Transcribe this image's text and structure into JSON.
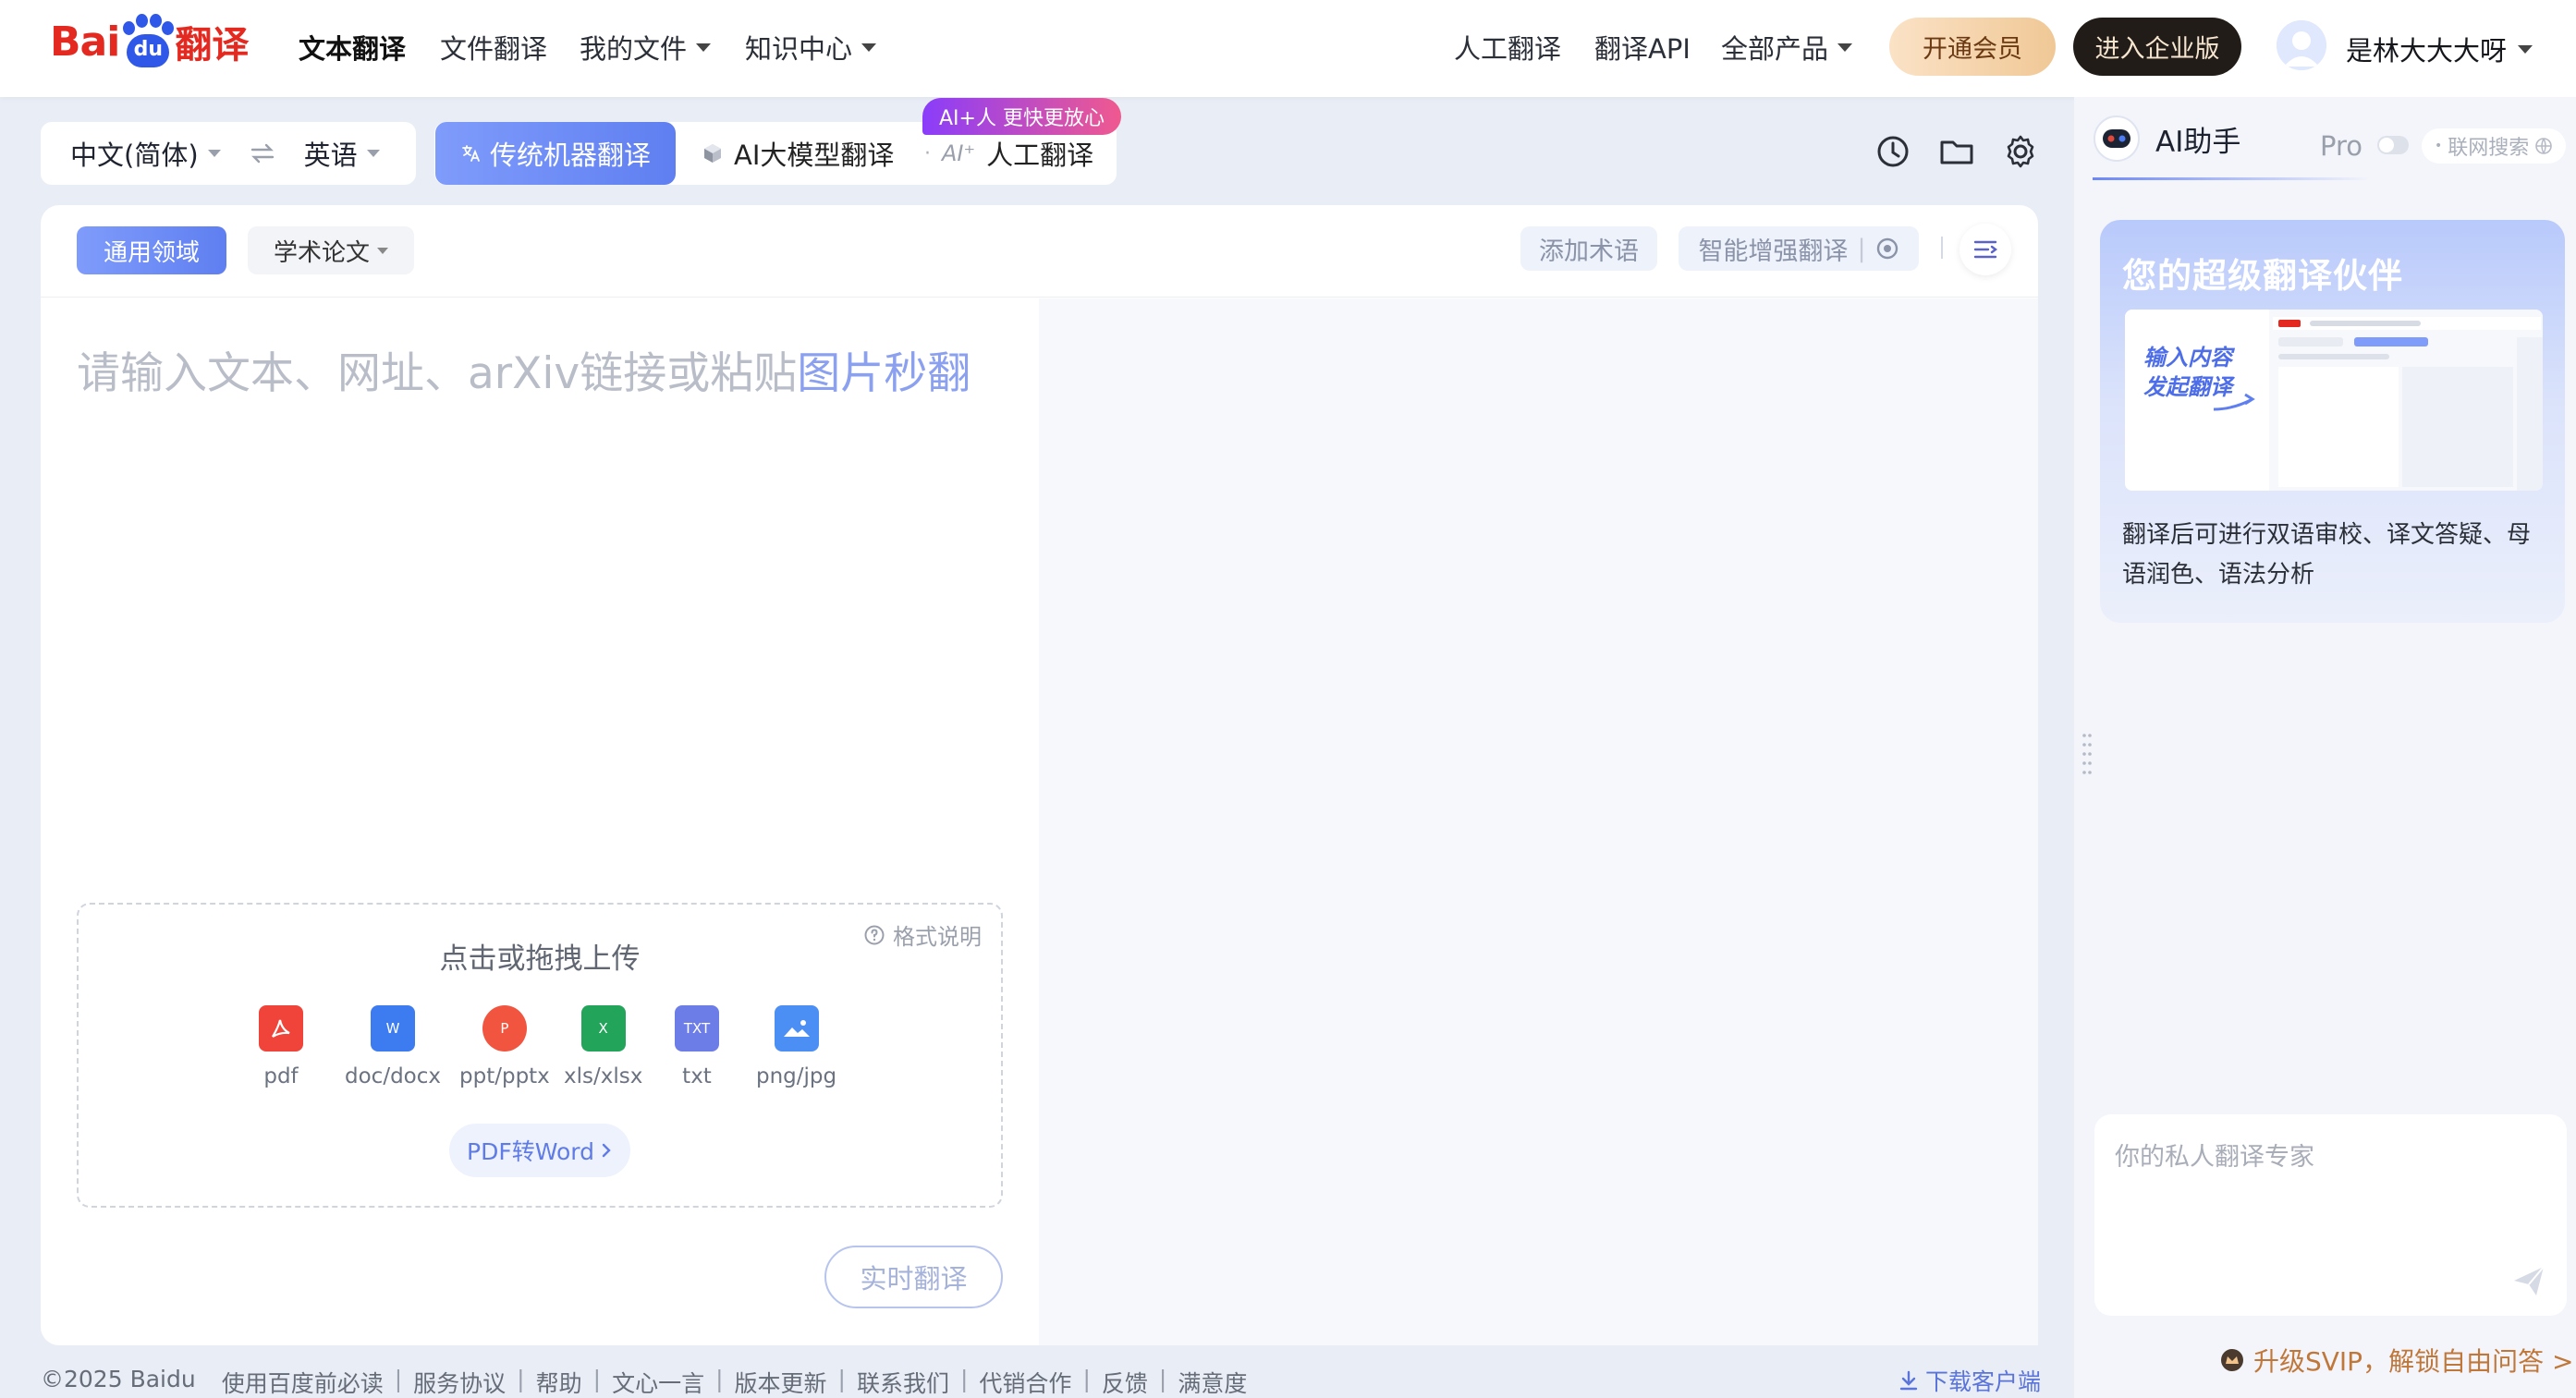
{
  "logo": {
    "bai": "Bai",
    "du": "du",
    "fanyi": "翻译"
  },
  "nav": {
    "left": [
      {
        "label": "文本翻译",
        "active": true,
        "caret": false
      },
      {
        "label": "文件翻译",
        "active": false,
        "caret": false
      },
      {
        "label": "我的文件",
        "active": false,
        "caret": true
      },
      {
        "label": "知识中心",
        "active": false,
        "caret": true
      }
    ],
    "right": [
      {
        "label": "人工翻译",
        "caret": false
      },
      {
        "label": "翻译API",
        "caret": false
      },
      {
        "label": "全部产品",
        "caret": true
      }
    ],
    "vip_button": "开通会员",
    "enterprise_button": "进入企业版",
    "username": "是林大大大呀"
  },
  "toolbar": {
    "source_lang": "中文(简体)",
    "target_lang": "英语",
    "swap_icon": "swap-arrows-icon",
    "modes": {
      "machine": "传统机器翻译",
      "llm": "AI大模型翻译",
      "human": "人工翻译",
      "human_badge": "AI+人 更快更放心"
    },
    "icons": [
      "history-icon",
      "folder-icon",
      "settings-icon"
    ]
  },
  "domain": {
    "general": "通用领域",
    "academic": "学术论文",
    "add_term": "添加术语",
    "enhance": "智能增强翻译"
  },
  "input": {
    "placeholder_main": "请输入文本、网址、arXiv链接或粘贴",
    "placeholder_link": "图片秒翻"
  },
  "upload": {
    "title": "点击或拖拽上传",
    "format_help": "格式说明",
    "types": [
      {
        "label": "pdf",
        "icon": "pdf-file-icon",
        "color": "#f0443a"
      },
      {
        "label": "doc/docx",
        "icon": "word-file-icon",
        "color": "#3d7cf0"
      },
      {
        "label": "ppt/pptx",
        "icon": "ppt-file-icon",
        "color": "#f2553f"
      },
      {
        "label": "xls/xlsx",
        "icon": "excel-file-icon",
        "color": "#22a55b"
      },
      {
        "label": "txt",
        "icon": "txt-file-icon",
        "color": "#6d7de8"
      },
      {
        "label": "png/jpg",
        "icon": "image-file-icon",
        "color": "#4b8ff5"
      }
    ],
    "pdf_to_word": "PDF转Word",
    "realtime": "实时翻译"
  },
  "footer": {
    "copyright": "©2025 Baidu",
    "links": [
      "使用百度前必读",
      "服务协议",
      "帮助",
      "文心一言",
      "版本更新",
      "联系我们",
      "代销合作",
      "反馈",
      "满意度"
    ],
    "download": "下载客户端"
  },
  "ai_panel": {
    "title": "AI助手",
    "pro": "Pro",
    "web_search": "联网搜索",
    "promo_title": "您的超级翻译伙伴",
    "promo_shot_text": "输入内容\n发起翻译",
    "promo_desc": "翻译后可进行双语审校、译文答疑、母语润色、语法分析",
    "chat_placeholder": "你的私人翻译专家",
    "upsell": "升级SVIP，解锁自由问答 >"
  },
  "colors": {
    "accent": "#6a86f3",
    "brand_red": "#e42a20",
    "brand_blue": "#2f57e8"
  }
}
